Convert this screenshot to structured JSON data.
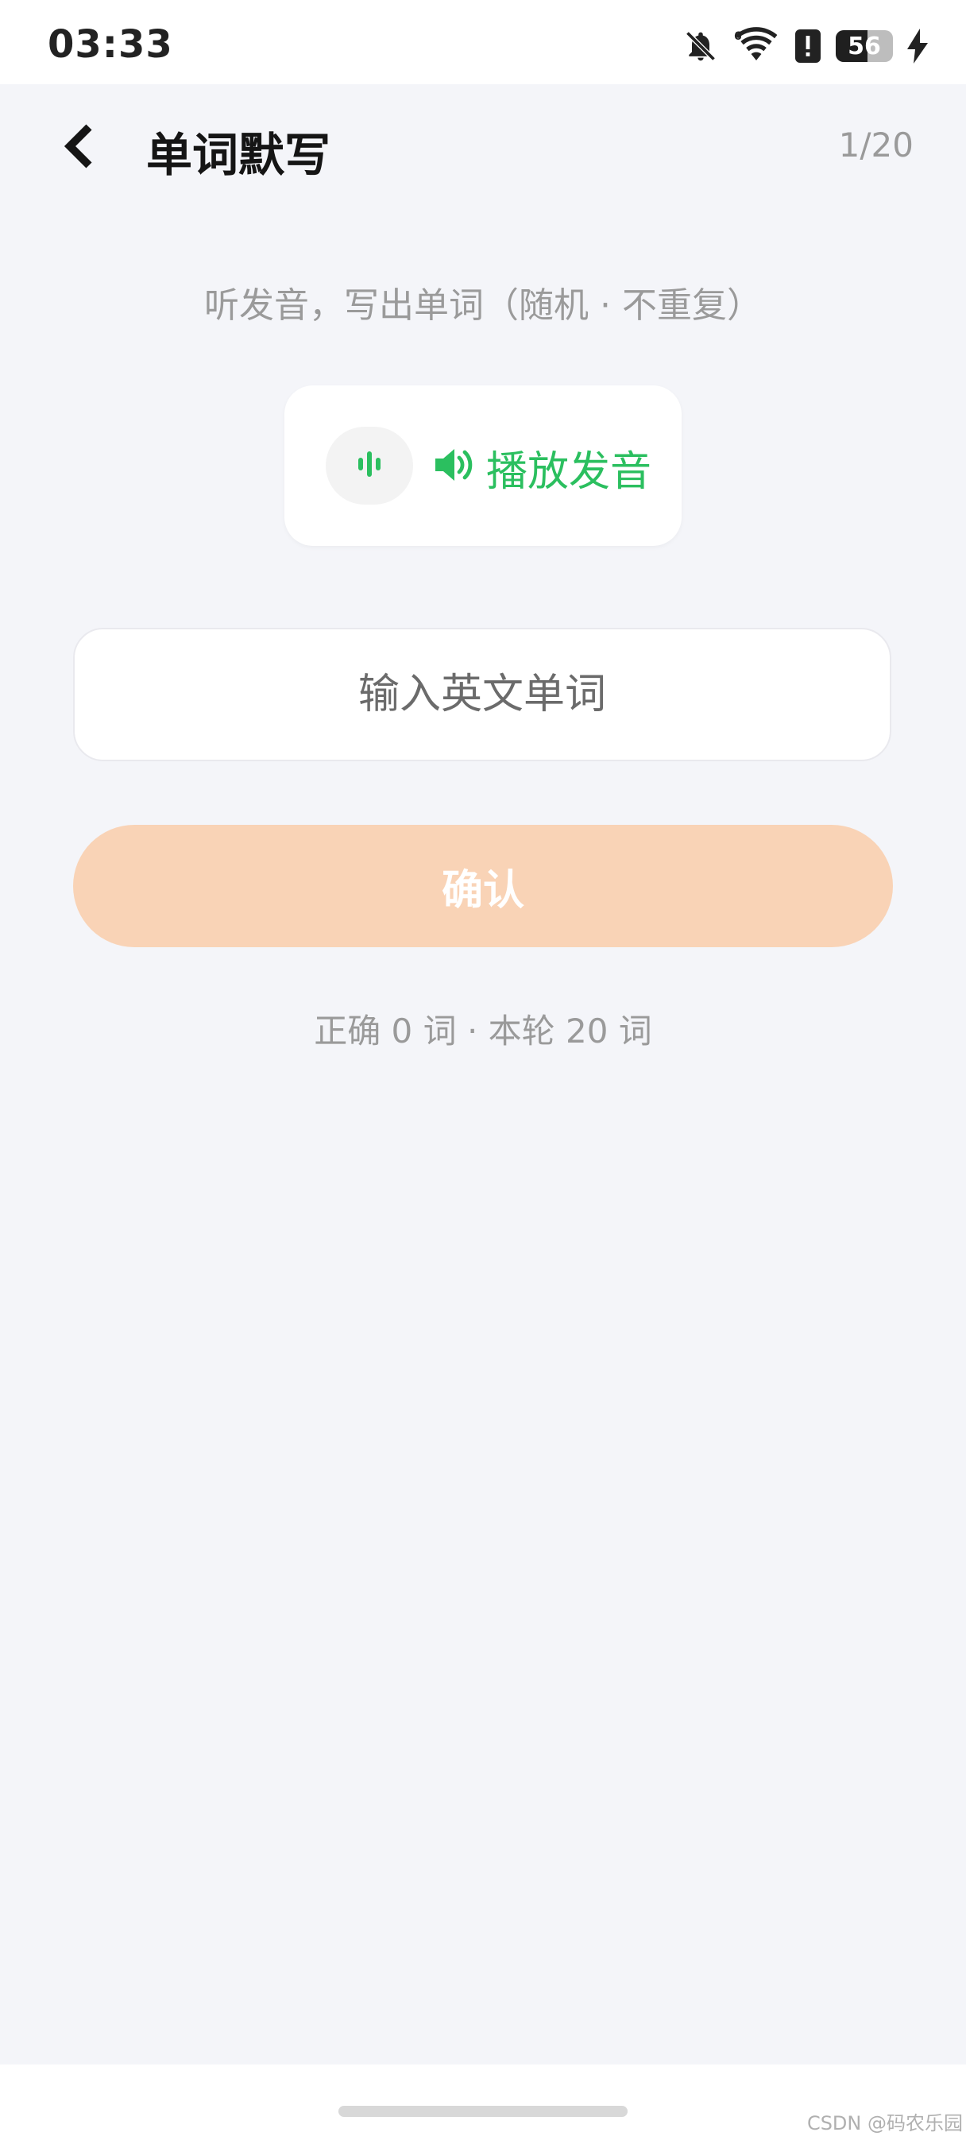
{
  "status_bar": {
    "time": "03:33",
    "battery_level": "56",
    "icons": [
      "bell-off-icon",
      "wifi-6-icon",
      "alert-icon",
      "battery-icon",
      "charging-icon"
    ]
  },
  "header": {
    "back_icon": "chevron-left-icon",
    "title": "单词默写",
    "progress": "1/20"
  },
  "instruction": "听发音，写出单词（随机 · 不重复）",
  "play": {
    "wave_icon": "audio-wave-icon",
    "speaker_icon": "speaker-icon",
    "label": "播放发音"
  },
  "input": {
    "value": "",
    "placeholder": "输入英文单词"
  },
  "confirm_label": "确认",
  "score_text": "正确 0 词 · 本轮 20 词",
  "watermark": "CSDN @码农乐园",
  "colors": {
    "accent_green": "#2bbf5f",
    "confirm_disabled": "#f9d3b6",
    "background": "#f4f5f9"
  }
}
